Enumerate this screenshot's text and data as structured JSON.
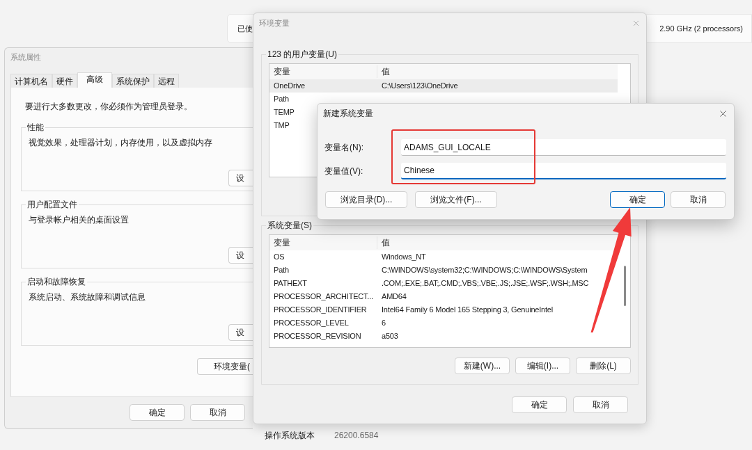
{
  "background": {
    "card": {
      "text_1": "已使",
      "text_2": "2.90 GHz (2 processors)"
    },
    "info_rows": [
      {
        "label": "操作系统版本",
        "value": "26200.6584"
      }
    ]
  },
  "system_properties": {
    "title": "系统属性",
    "tabs": [
      {
        "label": "计算机名",
        "selected": false
      },
      {
        "label": "硬件",
        "selected": false
      },
      {
        "label": "高级",
        "selected": true
      },
      {
        "label": "系统保护",
        "selected": false
      },
      {
        "label": "远程",
        "selected": false
      }
    ],
    "notice": "要进行大多数更改，你必须作为管理员登录。",
    "groups": [
      {
        "title": "性能",
        "description": "视觉效果，处理器计划，内存使用，以及虚拟内存",
        "button": "设"
      },
      {
        "title": "用户配置文件",
        "description": "与登录帐户相关的桌面设置",
        "button": "设"
      },
      {
        "title": "启动和故障恢复",
        "description": "系统启动、系统故障和调试信息",
        "button": "设"
      }
    ],
    "env_button": "环境变量(",
    "buttons": [
      "确定",
      "取消"
    ]
  },
  "env_window": {
    "title": "环境变量",
    "user_vars": {
      "title": "123 的用户变量(U)",
      "columns": [
        "变量",
        "值"
      ],
      "rows": [
        {
          "name": "OneDrive",
          "value": "C:\\Users\\123\\OneDrive",
          "selected": true
        },
        {
          "name": "Path",
          "selected": false
        },
        {
          "name": "TEMP",
          "selected": false
        },
        {
          "name": "TMP",
          "selected": false
        }
      ]
    },
    "system_vars": {
      "title": "系统变量(S)",
      "columns": [
        "变量",
        "值"
      ],
      "rows": [
        {
          "name": "OS",
          "value": "Windows_NT"
        },
        {
          "name": "Path",
          "value": "C:\\WINDOWS\\system32;C:\\WINDOWS;C:\\WINDOWS\\System"
        },
        {
          "name": "PATHEXT",
          "value": ".COM;.EXE;.BAT;.CMD;.VBS;.VBE;.JS;.JSE;.WSF;.WSH;.MSC"
        },
        {
          "name": "PROCESSOR_ARCHITECT...",
          "value": "AMD64"
        },
        {
          "name": "PROCESSOR_IDENTIFIER",
          "value": "Intel64 Family 6 Model 165 Stepping 3, GenuineIntel"
        },
        {
          "name": "PROCESSOR_LEVEL",
          "value": "6"
        },
        {
          "name": "PROCESSOR_REVISION",
          "value": "a503"
        }
      ],
      "buttons": [
        "新建(W)...",
        "编辑(I)...",
        "删除(L)"
      ]
    },
    "buttons": [
      "确定",
      "取消"
    ]
  },
  "new_var_dialog": {
    "title": "新建系统变量",
    "fields": [
      {
        "label": "变量名(N):",
        "value": "ADAMS_GUI_LOCALE",
        "focused": false
      },
      {
        "label": "变量值(V):",
        "value": "Chinese",
        "focused": true
      }
    ],
    "browse_buttons": [
      "浏览目录(D)...",
      "浏览文件(F)..."
    ],
    "buttons": [
      {
        "label": "确定",
        "focused": true
      },
      {
        "label": "取消",
        "focused": false
      }
    ]
  }
}
